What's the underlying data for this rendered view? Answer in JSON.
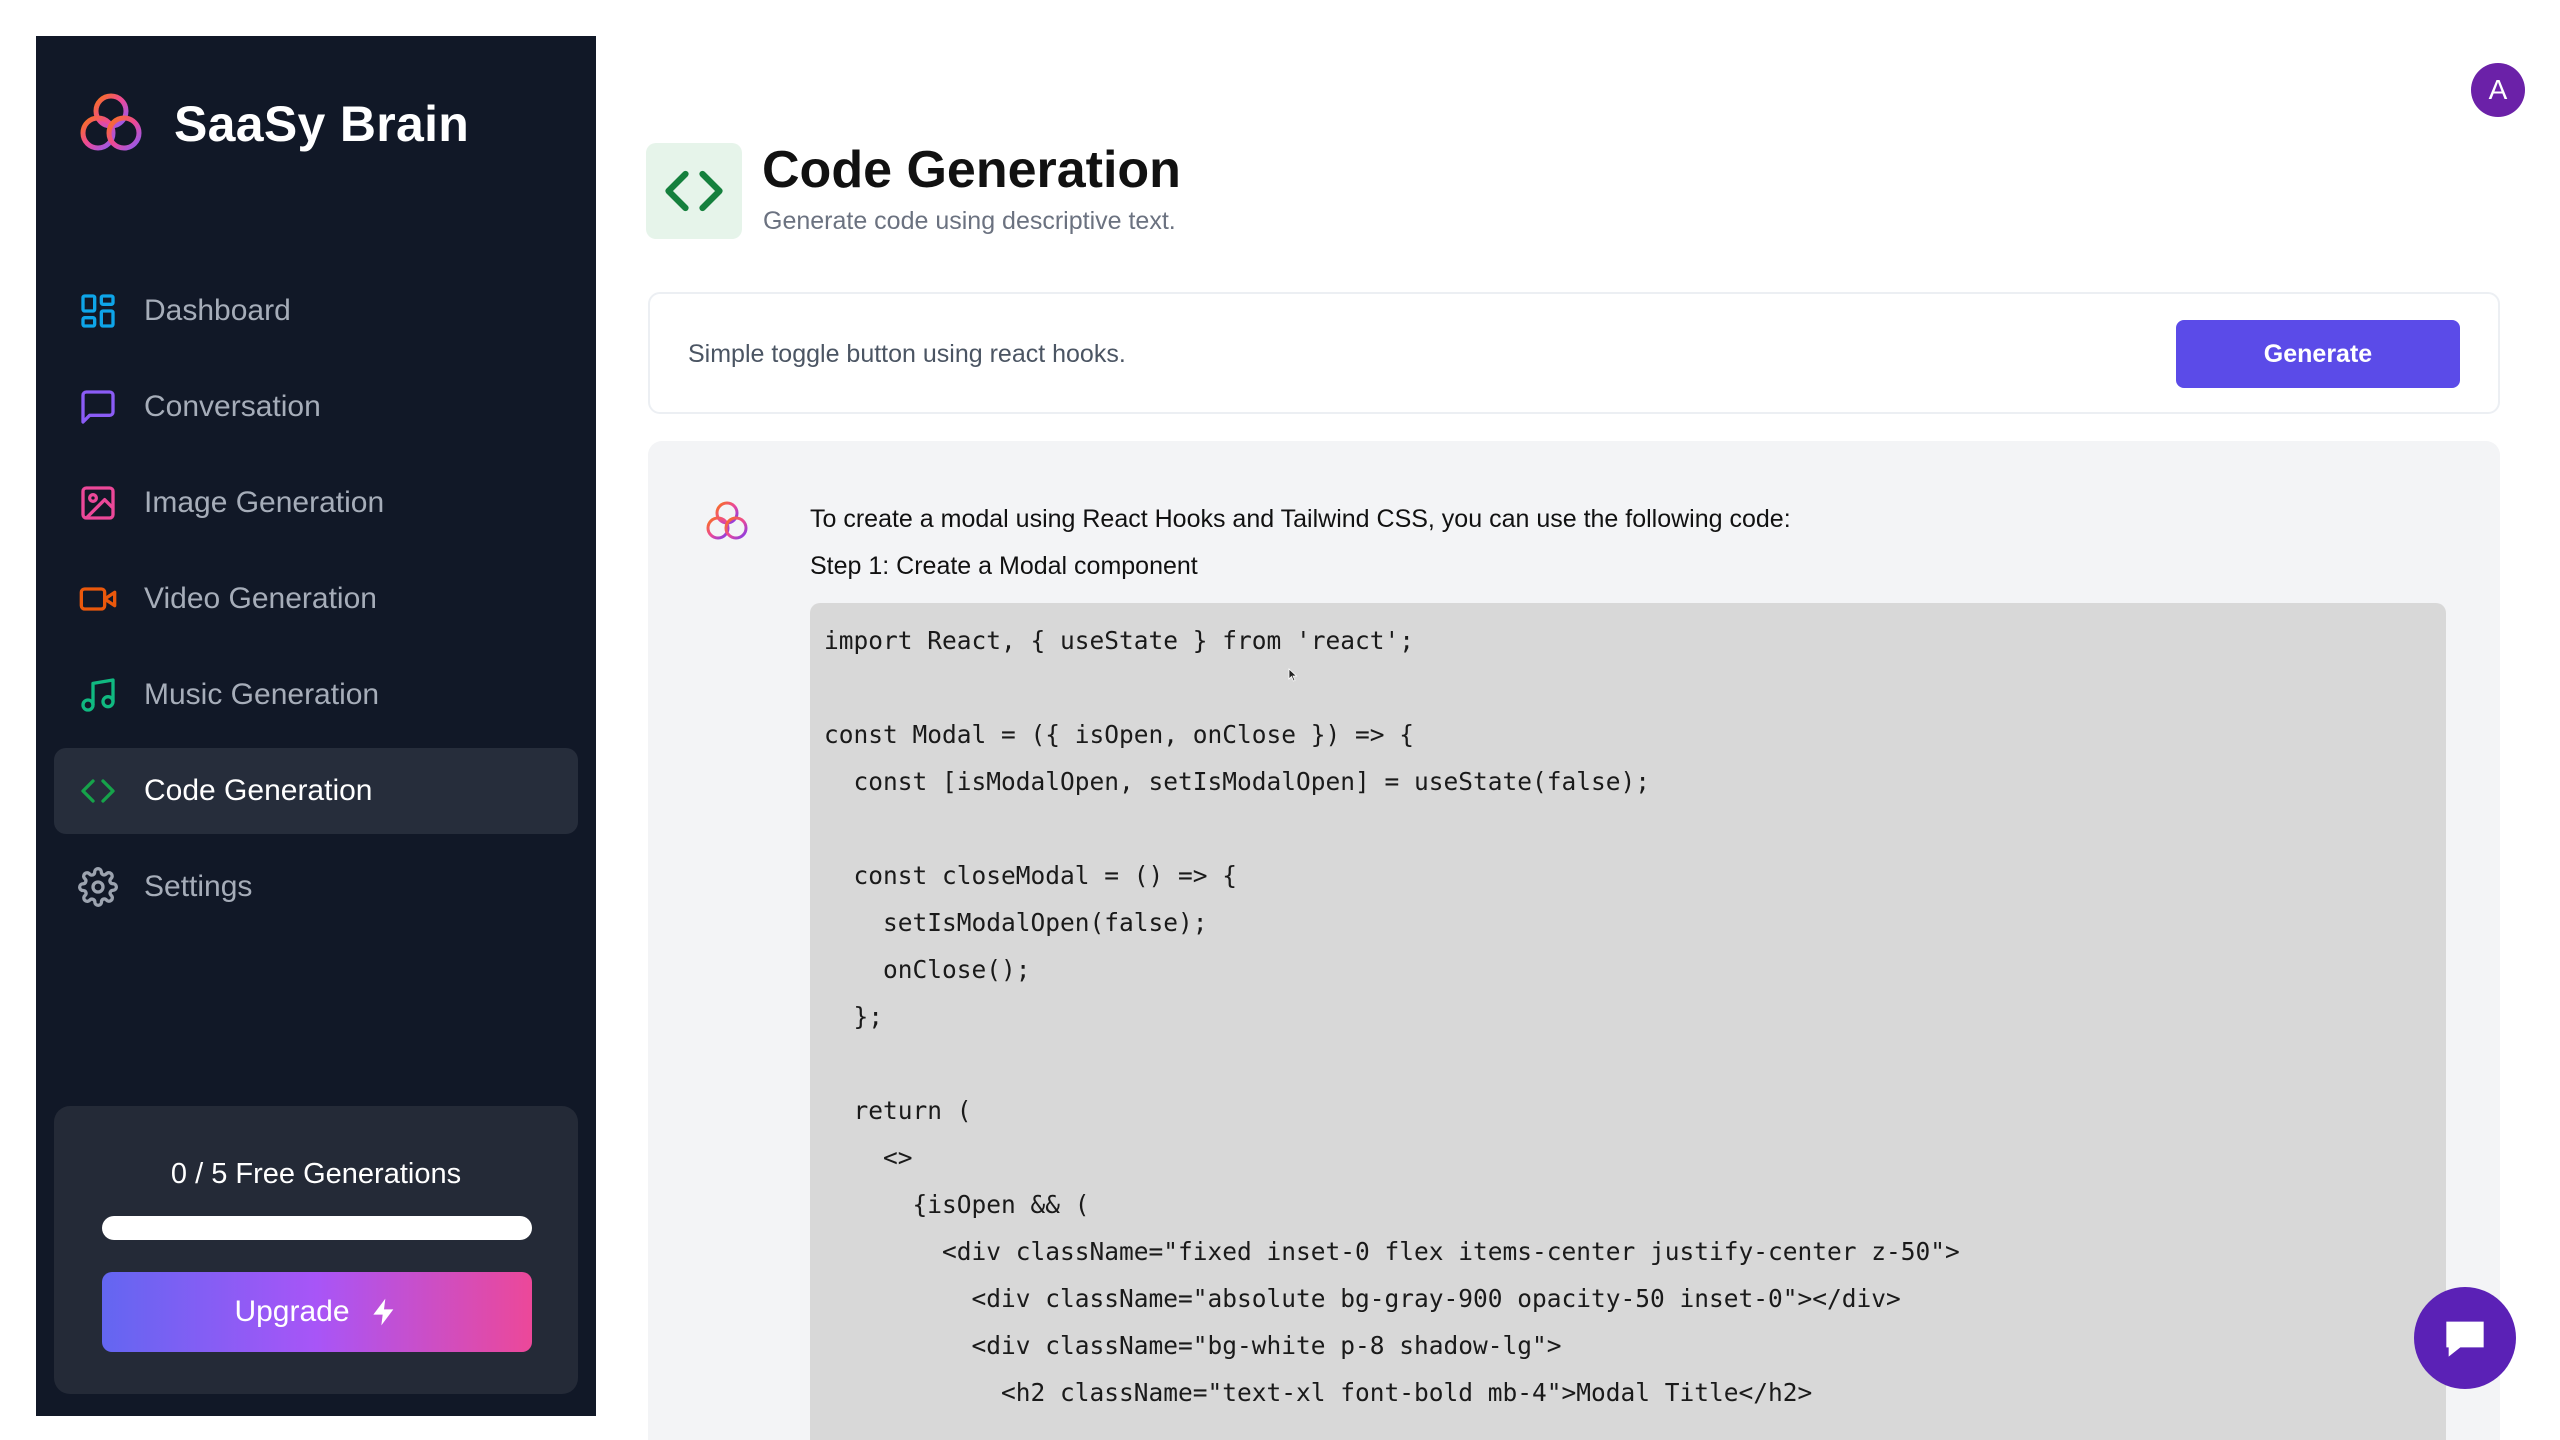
{
  "app": {
    "name": "SaaSy Brain",
    "logo_icon": "trinity-rings-logo",
    "accent_color": "#5b4be8"
  },
  "sidebar": {
    "items": [
      {
        "label": "Dashboard",
        "icon": "dashboard-icon",
        "color": "#0ea5e9",
        "active": false
      },
      {
        "label": "Conversation",
        "icon": "message-square-icon",
        "color": "#8b5cf6",
        "active": false
      },
      {
        "label": "Image Generation",
        "icon": "image-icon",
        "color": "#ec4899",
        "active": false
      },
      {
        "label": "Video Generation",
        "icon": "video-icon",
        "color": "#ea580c",
        "active": false
      },
      {
        "label": "Music Generation",
        "icon": "music-icon",
        "color": "#10b981",
        "active": false
      },
      {
        "label": "Code Generation",
        "icon": "code-icon",
        "color": "#16a34a",
        "active": true
      },
      {
        "label": "Settings",
        "icon": "settings-icon",
        "color": "#9ca3af",
        "active": false
      }
    ],
    "usage": {
      "text": "0 / 5 Free Generations",
      "used": 0,
      "limit": 5,
      "progress": 0
    },
    "upgrade_label": "Upgrade"
  },
  "user": {
    "avatar_initial": "A"
  },
  "header": {
    "icon": "code-icon",
    "title": "Code Generation",
    "subtitle": "Generate code using descriptive text."
  },
  "prompt": {
    "value": "Simple toggle button using react hooks.",
    "placeholder": "",
    "button_label": "Generate"
  },
  "response": {
    "intro": "To create a modal using React Hooks and Tailwind CSS, you can use the following code:",
    "step": "Step 1: Create a Modal component",
    "code": "import React, { useState } from 'react';\n\nconst Modal = ({ isOpen, onClose }) => {\n  const [isModalOpen, setIsModalOpen] = useState(false);\n\n  const closeModal = () => {\n    setIsModalOpen(false);\n    onClose();\n  };\n\n  return (\n    <>\n      {isOpen && (\n        <div className=\"fixed inset-0 flex items-center justify-center z-50\">\n          <div className=\"absolute bg-gray-900 opacity-50 inset-0\"></div>\n          <div className=\"bg-white p-8 shadow-lg\">\n            <h2 className=\"text-xl font-bold mb-4\">Modal Title</h2>"
  },
  "chat_widget": {
    "icon": "chat-bubble-icon"
  }
}
